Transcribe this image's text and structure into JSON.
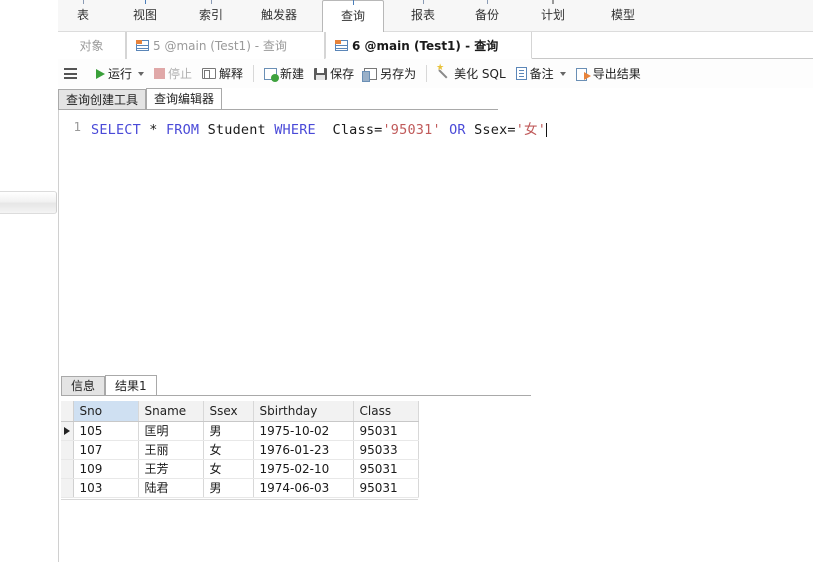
{
  "ribbon": {
    "items": [
      {
        "label": "表",
        "icon": "table-icon",
        "active": false
      },
      {
        "label": "视图",
        "icon": "view-icon",
        "active": false
      },
      {
        "label": "索引",
        "icon": "index-icon",
        "active": false
      },
      {
        "label": "触发器",
        "icon": "trigger-icon",
        "active": false
      },
      {
        "label": "查询",
        "icon": "query-icon",
        "active": true
      },
      {
        "label": "报表",
        "icon": "report-icon",
        "active": false
      },
      {
        "label": "备份",
        "icon": "backup-icon",
        "active": false
      },
      {
        "label": "计划",
        "icon": "schedule-icon",
        "active": false
      },
      {
        "label": "模型",
        "icon": "model-icon",
        "active": false
      }
    ]
  },
  "tabstrip": {
    "object_label": "对象",
    "tabs": [
      {
        "label": "5 @main (Test1) - 查询",
        "active": false
      },
      {
        "label": "6 @main (Test1) - 查询",
        "active": true
      }
    ]
  },
  "toolbar": {
    "menu_icon": "hamburger-icon",
    "buttons": [
      {
        "label": "运行",
        "icon": "run-icon",
        "disabled": false,
        "caret": true
      },
      {
        "label": "停止",
        "icon": "stop-icon",
        "disabled": true,
        "caret": false
      },
      {
        "label": "解释",
        "icon": "explain-icon",
        "disabled": false,
        "caret": false
      },
      {
        "label": "新建",
        "icon": "new-icon",
        "disabled": false,
        "caret": false
      },
      {
        "label": "保存",
        "icon": "save-icon",
        "disabled": false,
        "caret": false
      },
      {
        "label": "另存为",
        "icon": "save-as-icon",
        "disabled": false,
        "caret": false
      },
      {
        "label": "美化 SQL",
        "icon": "beautify-icon",
        "disabled": false,
        "caret": false
      },
      {
        "label": "备注",
        "icon": "note-icon",
        "disabled": false,
        "caret": true
      },
      {
        "label": "导出结果",
        "icon": "export-icon",
        "disabled": false,
        "caret": false
      }
    ]
  },
  "subtabs": [
    {
      "label": "查询创建工具",
      "active": false
    },
    {
      "label": "查询编辑器",
      "active": true
    }
  ],
  "editor": {
    "line_number": "1",
    "sql_tokens": [
      {
        "t": "SELECT",
        "c": "kw"
      },
      {
        "t": " ",
        "c": "op"
      },
      {
        "t": "*",
        "c": "op"
      },
      {
        "t": " ",
        "c": "op"
      },
      {
        "t": "FROM",
        "c": "kw"
      },
      {
        "t": " ",
        "c": "op"
      },
      {
        "t": "Student",
        "c": "op"
      },
      {
        "t": " ",
        "c": "op"
      },
      {
        "t": "WHERE",
        "c": "kw"
      },
      {
        "t": "  ",
        "c": "op"
      },
      {
        "t": "Class=",
        "c": "op"
      },
      {
        "t": "'95031'",
        "c": "str"
      },
      {
        "t": " ",
        "c": "op"
      },
      {
        "t": "OR",
        "c": "kw"
      },
      {
        "t": " ",
        "c": "op"
      },
      {
        "t": "Ssex=",
        "c": "op"
      },
      {
        "t": "'女'",
        "c": "str"
      }
    ],
    "sql_text": "SELECT * FROM Student WHERE  Class='95031' OR Ssex='女'"
  },
  "results": {
    "tabs": [
      {
        "label": "信息",
        "active": false
      },
      {
        "label": "结果1",
        "active": true
      }
    ],
    "columns": [
      "Sno",
      "Sname",
      "Ssex",
      "Sbirthday",
      "Class"
    ],
    "selected_column": "Sno",
    "current_row_index": 0,
    "rows": [
      {
        "Sno": "105",
        "Sname": "匡明",
        "Ssex": "男",
        "Sbirthday": "1975-10-02",
        "Class": "95031"
      },
      {
        "Sno": "107",
        "Sname": "王丽",
        "Ssex": "女",
        "Sbirthday": "1976-01-23",
        "Class": "95033"
      },
      {
        "Sno": "109",
        "Sname": "王芳",
        "Ssex": "女",
        "Sbirthday": "1975-02-10",
        "Class": "95031"
      },
      {
        "Sno": "103",
        "Sname": "陆君",
        "Ssex": "男",
        "Sbirthday": "1974-06-03",
        "Class": "95031"
      }
    ]
  },
  "colors": {
    "keyword": "#4a4ad8",
    "string": "#c05a5a",
    "selected_header": "#cfe0f2",
    "accent_orange": "#e8833a"
  }
}
